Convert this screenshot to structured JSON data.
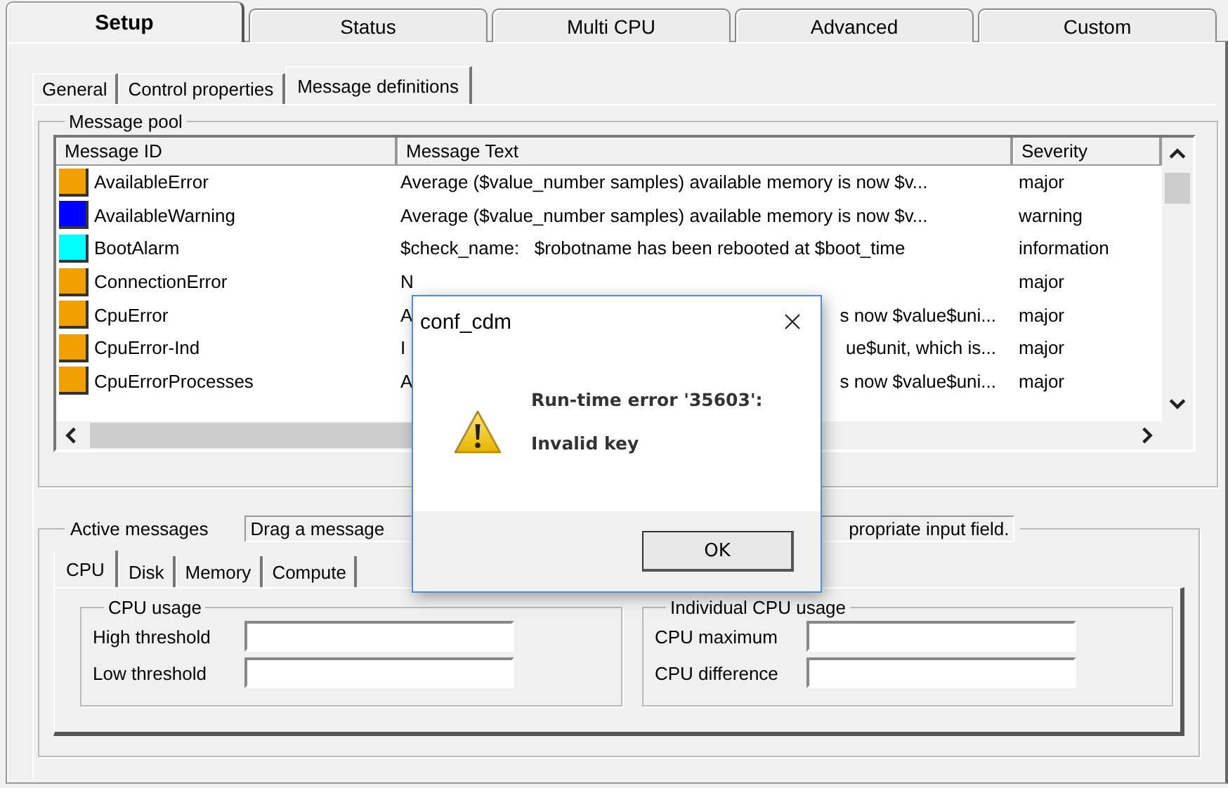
{
  "tabs": [
    {
      "label": "Setup",
      "selected": true
    },
    {
      "label": "Status",
      "selected": false
    },
    {
      "label": "Multi CPU",
      "selected": false
    },
    {
      "label": "Advanced",
      "selected": false
    },
    {
      "label": "Custom",
      "selected": false
    }
  ],
  "subtabs": [
    {
      "label": "General",
      "selected": false
    },
    {
      "label": "Control properties",
      "selected": false
    },
    {
      "label": "Message definitions",
      "selected": true
    }
  ],
  "message_pool": {
    "title": "Message pool",
    "columns": [
      "Message ID",
      "Message Text",
      "Severity"
    ],
    "rows": [
      {
        "id": "AvailableError",
        "color": "#f0a000",
        "text": "Average ($value_number samples) available memory is now $v...",
        "severity": "major"
      },
      {
        "id": "AvailableWarning",
        "color": "#0000ff",
        "text": "Average ($value_number samples) available memory is now $v...",
        "severity": "warning"
      },
      {
        "id": "BootAlarm",
        "color": "#00ffff",
        "text": "$check_name:   $robotname has been rebooted at $boot_time",
        "severity": "information"
      },
      {
        "id": "ConnectionError",
        "color": "#f0a000",
        "text": "N",
        "severity": "major"
      },
      {
        "id": "CpuError",
        "color": "#f0a000",
        "text": "A",
        "text_tail": "s now $value$uni...",
        "severity": "major"
      },
      {
        "id": "CpuError-Ind",
        "color": "#f0a000",
        "text": "I",
        "text_tail": "ue$unit, which is...",
        "severity": "major"
      },
      {
        "id": "CpuErrorProcesses",
        "color": "#f0a000",
        "text": "A",
        "text_tail": "s now $value$uni...",
        "severity": "major"
      }
    ]
  },
  "active_messages": {
    "title": "Active messages",
    "hint": "Drag a message",
    "hint_tail": "propriate input field.",
    "tabs": [
      {
        "label": "CPU",
        "selected": true
      },
      {
        "label": "Disk",
        "selected": false
      },
      {
        "label": "Memory",
        "selected": false
      },
      {
        "label": "Compute",
        "selected": false
      }
    ],
    "groups": [
      {
        "title": "CPU usage",
        "fields": [
          {
            "label": "High threshold"
          },
          {
            "label": "Low threshold"
          }
        ]
      },
      {
        "title": "Individual CPU usage",
        "fields": [
          {
            "label": "CPU maximum"
          },
          {
            "label": "CPU difference"
          }
        ]
      }
    ]
  },
  "dialog": {
    "title": "conf_cdm",
    "heading": "Run-time error '35603':",
    "message": "Invalid key",
    "button": "OK"
  }
}
